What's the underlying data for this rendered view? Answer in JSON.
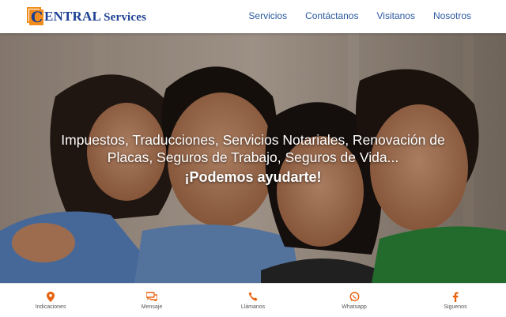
{
  "header": {
    "logo": {
      "letter": "C",
      "brand": "ENTRAL",
      "services": "Services"
    },
    "nav": [
      {
        "label": "Servicios"
      },
      {
        "label": "Contáctanos"
      },
      {
        "label": "Visitanos"
      },
      {
        "label": "Nosotros"
      }
    ]
  },
  "hero": {
    "line1": "Impuestos, Traducciones, Servicios Notariales, Renovación de",
    "line2": "Placas, Seguros de Trabajo, Seguros de Vida...",
    "cta": "¡Podemos ayudarte!"
  },
  "bottom_bar": {
    "accent": "#e8620e",
    "items": [
      {
        "label": "Indicaciones",
        "icon": "map-marker-icon"
      },
      {
        "label": "Mensaje",
        "icon": "chat-bubbles-icon"
      },
      {
        "label": "Llámanos",
        "icon": "phone-icon"
      },
      {
        "label": "Whatsapp",
        "icon": "whatsapp-icon"
      },
      {
        "label": "Siguenos",
        "icon": "facebook-icon"
      }
    ]
  },
  "colors": {
    "brand_blue": "#1b3f93",
    "brand_orange": "#f28c1c",
    "nav_link": "#2c5aa0"
  }
}
